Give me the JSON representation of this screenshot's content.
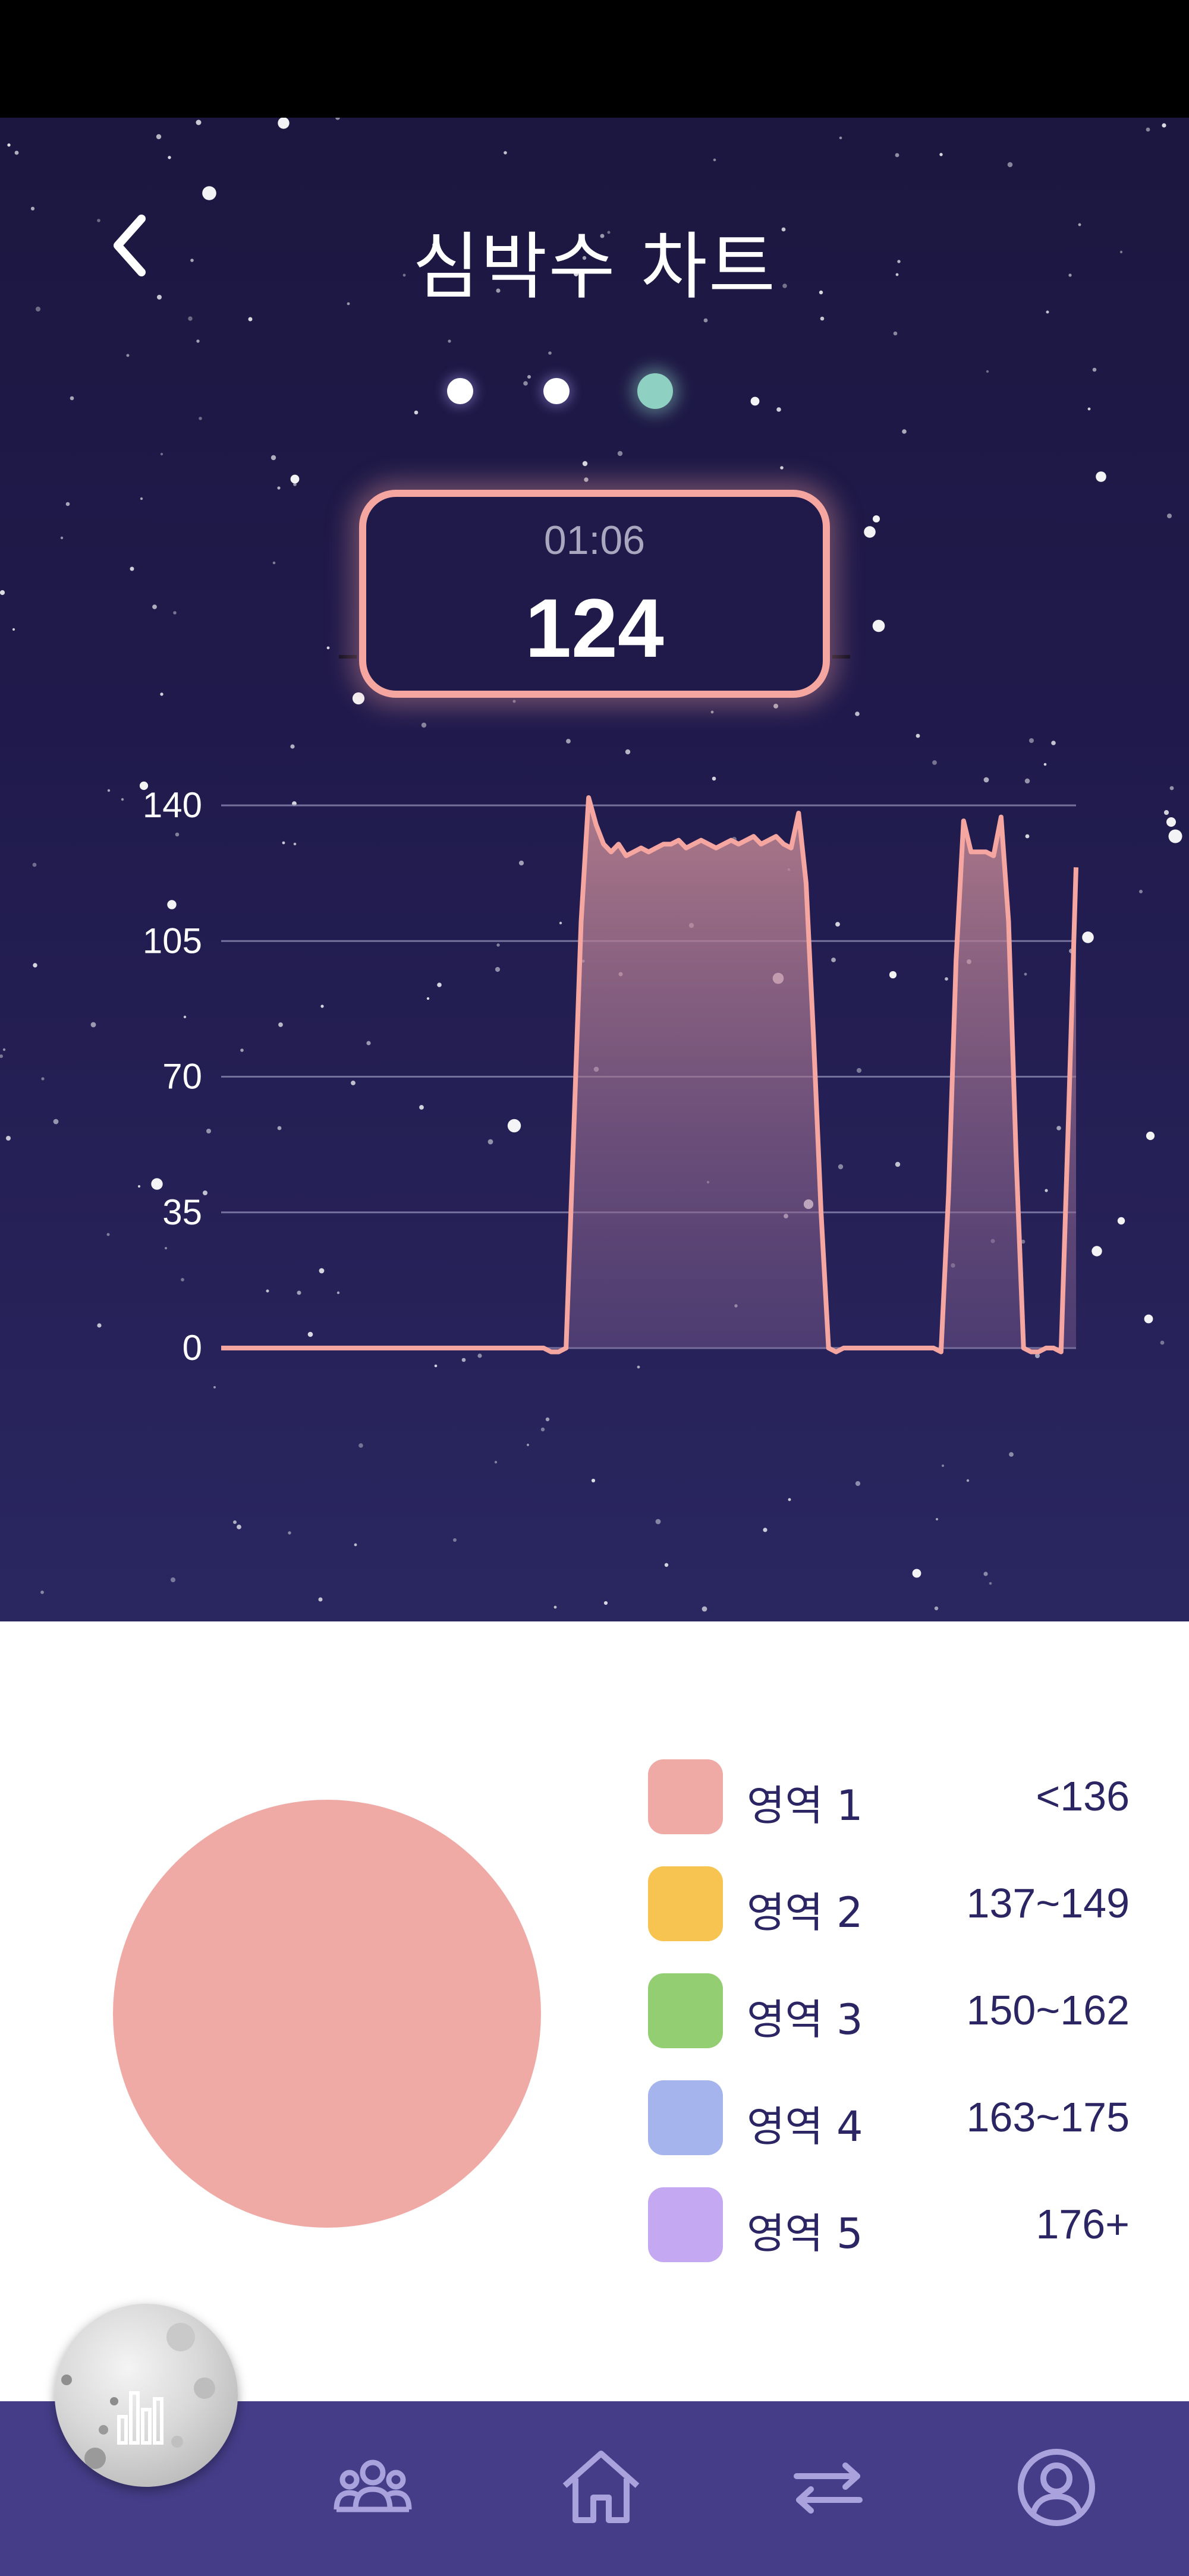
{
  "header": {
    "title": "심박수 차트",
    "back_icon": "chevron-left-icon"
  },
  "pager": {
    "count": 3,
    "active_index": 2
  },
  "readout": {
    "time": "01:06",
    "value": "124"
  },
  "chart_data": {
    "type": "area",
    "title": "",
    "xlabel": "",
    "ylabel": "",
    "ylim": [
      0,
      140
    ],
    "yticks": [
      0,
      35,
      70,
      105,
      140
    ],
    "grid": true,
    "series": [
      {
        "values": [
          0,
          0,
          0,
          0,
          0,
          0,
          0,
          0,
          0,
          0,
          0,
          0,
          0,
          0,
          0,
          0,
          0,
          0,
          0,
          0,
          0,
          0,
          0,
          0,
          0,
          0,
          0,
          0,
          0,
          0,
          0,
          0,
          0,
          0,
          0,
          0,
          0,
          0,
          0,
          0,
          0,
          0,
          0,
          0,
          -1,
          -1,
          0,
          55,
          110,
          142,
          135,
          130,
          128,
          130,
          127,
          128,
          129,
          128,
          129,
          130,
          130,
          131,
          129,
          130,
          131,
          130,
          129,
          130,
          131,
          130,
          131,
          132,
          130,
          131,
          132,
          130,
          129,
          138,
          120,
          80,
          35,
          0,
          -1,
          0,
          0,
          0,
          0,
          0,
          0,
          0,
          0,
          0,
          0,
          0,
          0,
          0,
          -1,
          40,
          100,
          136,
          128,
          128,
          128,
          127,
          137,
          110,
          50,
          0,
          -1,
          -1,
          0,
          0,
          -1,
          60,
          124
        ]
      }
    ]
  },
  "zones": [
    {
      "name": "영역 1",
      "range": "<136",
      "color": "#f0aaa6"
    },
    {
      "name": "영역 2",
      "range": "137~149",
      "color": "#f7c452"
    },
    {
      "name": "영역 3",
      "range": "150~162",
      "color": "#93cf72"
    },
    {
      "name": "영역 4",
      "range": "163~175",
      "color": "#a6b4ee"
    },
    {
      "name": "영역 5",
      "range": "176+",
      "color": "#c4a8f2"
    }
  ],
  "zone_distribution": [
    1,
    0,
    0,
    0,
    0
  ],
  "nav": {
    "items": [
      {
        "icon": "group-icon"
      },
      {
        "icon": "home-icon"
      },
      {
        "icon": "transfer-icon"
      },
      {
        "icon": "profile-icon"
      }
    ],
    "floating_icon": "moon-chart-icon"
  },
  "colors": {
    "background_top": "#1c1740",
    "background_bottom": "#2a2660",
    "accent_line": "#f5a6a0",
    "active_dot": "#8ed0c2",
    "nav_bar": "#453d88",
    "text_dark": "#2b2564"
  }
}
